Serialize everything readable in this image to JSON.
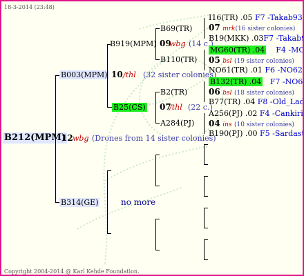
{
  "header": "18-3-2014 (23:48)",
  "footer": "Copyright 2004-2014 @ Karl Kehde Foundation.",
  "root": {
    "id": "B212(MPM)",
    "year": "12",
    "breeder": "wbg",
    "sisters": "(Drones from 14 sister colonies)"
  },
  "sire": {
    "id": "B003(MPM)",
    "year": "10",
    "breeder": "/thl",
    "sisters": "(32 sister colonies)"
  },
  "ss": {
    "id": "B919(MPM)",
    "year": "09",
    "breeder": "wbg",
    "sisters": "(14 c.)"
  },
  "sd": {
    "id": "B25(CS)",
    "year": "07",
    "breeder": "/thl",
    "sisters": "(22 c.)"
  },
  "g3": [
    "B69(TR)",
    "B110(TR)",
    "B2(TR)",
    "A284(PJ)"
  ],
  "g4": [
    {
      "id": "I16(TR)",
      "val": ".05",
      "breeder": "F7 -Takab93aR"
    },
    {
      "year": "07",
      "breeder": "mrk",
      "sisters": "(16 sister colonies)"
    },
    {
      "id": "B19(MKK)",
      "val": ".03",
      "breeder": "F7 -Takab93aR"
    },
    {
      "id": "MG60(TR) .04",
      "breeder": "F4 -MG00R"
    },
    {
      "year": "05",
      "breeder": "bsl",
      "sisters": "(19 sister colonies)"
    },
    {
      "id": "NO61(TR)",
      "val": ".01",
      "breeder": "F6 -NO6294R"
    },
    {
      "id": "B132(TR) .04",
      "breeder": "F7 -NO6294R"
    },
    {
      "year": "06",
      "breeder": "bsl",
      "sisters": "(18 sister colonies)"
    },
    {
      "id": "B77(TR)",
      "val": ".04",
      "breeder": "F8 -Old_Lady"
    },
    {
      "id": "A256(PJ)",
      "val": ".02",
      "breeder": "F4 -Cankiri97Q"
    },
    {
      "year": "04",
      "breeder": "ins",
      "sisters": "(10 sister colonies)"
    },
    {
      "id": "B190(PJ)",
      "val": ".00",
      "breeder": "F5 -Sardast93R"
    }
  ],
  "dam": {
    "id": "B314(GE)",
    "note": "no more"
  }
}
